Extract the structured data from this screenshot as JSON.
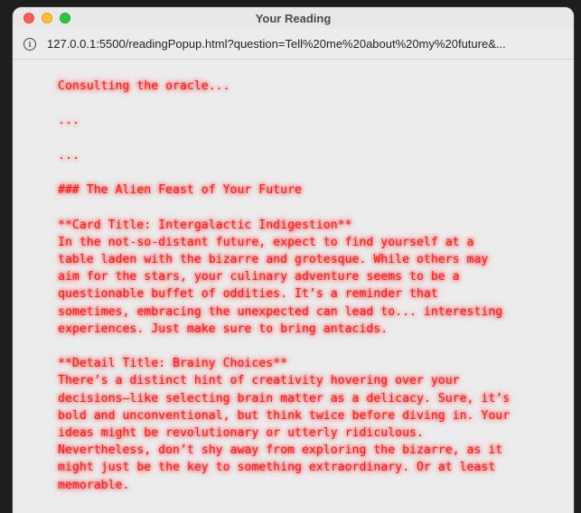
{
  "window": {
    "title": "Your Reading",
    "url": "127.0.0.1:5500/readingPopup.html?question=Tell%20me%20about%20my%20future&..."
  },
  "content": {
    "status": "Consulting the oracle...",
    "dots1": "...",
    "dots2": "...",
    "heading": "### The Alien Feast of Your Future",
    "card_title": "**Card Title: Intergalactic Indigestion**",
    "card_lines": [
      "In the not-so-distant future, expect to find yourself at a",
      "table laden with the bizarre and grotesque. While others may",
      "aim for the stars, your culinary adventure seems to be a",
      "questionable buffet of oddities. It’s a reminder that",
      "sometimes, embracing the unexpected can lead to... interesting",
      "experiences. Just make sure to bring antacids."
    ],
    "detail_title": "**Detail Title: Brainy Choices**",
    "detail_lines": [
      "There’s a distinct hint of creativity hovering over your",
      "decisions—like selecting brain matter as a delicacy. Sure, it’s",
      "bold and unconventional, but think twice before diving in. Your",
      "ideas might be revolutionary or utterly ridiculous.",
      "Nevertheless, don’t shy away from exploring the bizarre, as it",
      "might just be the key to something extraordinary. Or at least",
      "memorable."
    ]
  },
  "colors": {
    "text": "#ff1a1a",
    "background": "#ececec"
  }
}
